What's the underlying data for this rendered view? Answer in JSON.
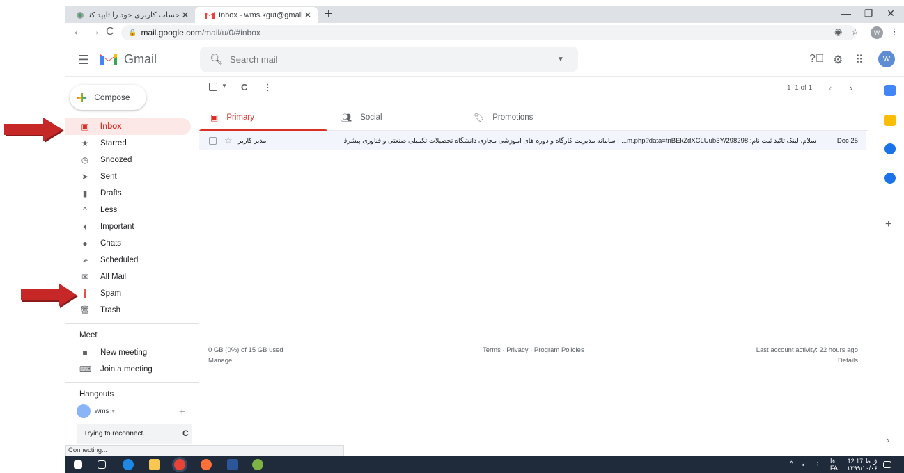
{
  "browser": {
    "tabs": [
      {
        "title": "حساب کاربری خود را تایید کنید",
        "close": "✕"
      },
      {
        "title": "Inbox - wms.kgut@gmail.com - (",
        "close": "✕"
      }
    ],
    "new_tab": "+",
    "url_host": "mail.google.com",
    "url_path": "/mail/u/0/#inbox",
    "profile_initial": "W"
  },
  "gmail": {
    "brand": "Gmail",
    "search_placeholder": "Search mail",
    "avatar_initial": "W",
    "compose_label": "Compose",
    "nav": [
      {
        "label": "Inbox",
        "icon": "inbox-icon"
      },
      {
        "label": "Starred",
        "icon": "star-icon"
      },
      {
        "label": "Snoozed",
        "icon": "clock-icon"
      },
      {
        "label": "Sent",
        "icon": "send-icon"
      },
      {
        "label": "Drafts",
        "icon": "draft-icon"
      },
      {
        "label": "Less",
        "icon": "chevron-up-icon"
      },
      {
        "label": "Important",
        "icon": "important-icon"
      },
      {
        "label": "Chats",
        "icon": "chat-icon"
      },
      {
        "label": "Scheduled",
        "icon": "scheduled-icon"
      },
      {
        "label": "All Mail",
        "icon": "mail-icon"
      },
      {
        "label": "Spam",
        "icon": "spam-icon"
      },
      {
        "label": "Trash",
        "icon": "trash-icon"
      }
    ],
    "meet": {
      "title": "Meet",
      "new_meeting": "New meeting",
      "join_meeting": "Join a meeting"
    },
    "hangouts": {
      "title": "Hangouts",
      "user": "wms",
      "reconnect": "Trying to reconnect..."
    },
    "pagination": "1–1 of 1",
    "categories": [
      {
        "label": "Primary"
      },
      {
        "label": "Social"
      },
      {
        "label": "Promotions"
      }
    ],
    "emails": [
      {
        "sender": "مدیر کاربر",
        "subject": "سلام، لینک تائید ثبت نام: m.php?data=tnBEkZdXCLUub3Y/298298... - سامانه مدیریت کارگاه و دوره های آموزشی مجازی دانشگاه تحصیلات تکمیلی صنعتی و فناوری پیشرفته",
        "date": "Dec 25"
      }
    ],
    "footer": {
      "storage": "0 GB (0%) of 15 GB used",
      "manage": "Manage",
      "links": "Terms · Privacy · Program Policies",
      "activity": "Last account activity: 22 hours ago",
      "details": "Details"
    }
  },
  "status": "Connecting...",
  "taskbar": {
    "lang_top": "فا",
    "lang_bottom": "FA",
    "time": "12:17 ق.ظ",
    "date": "۱۳۹۹/۱۰/۰۶"
  },
  "colors": {
    "accent_red": "#d93025",
    "arrow_red": "#b71c1c",
    "row_bg": "#f2f6fc"
  }
}
